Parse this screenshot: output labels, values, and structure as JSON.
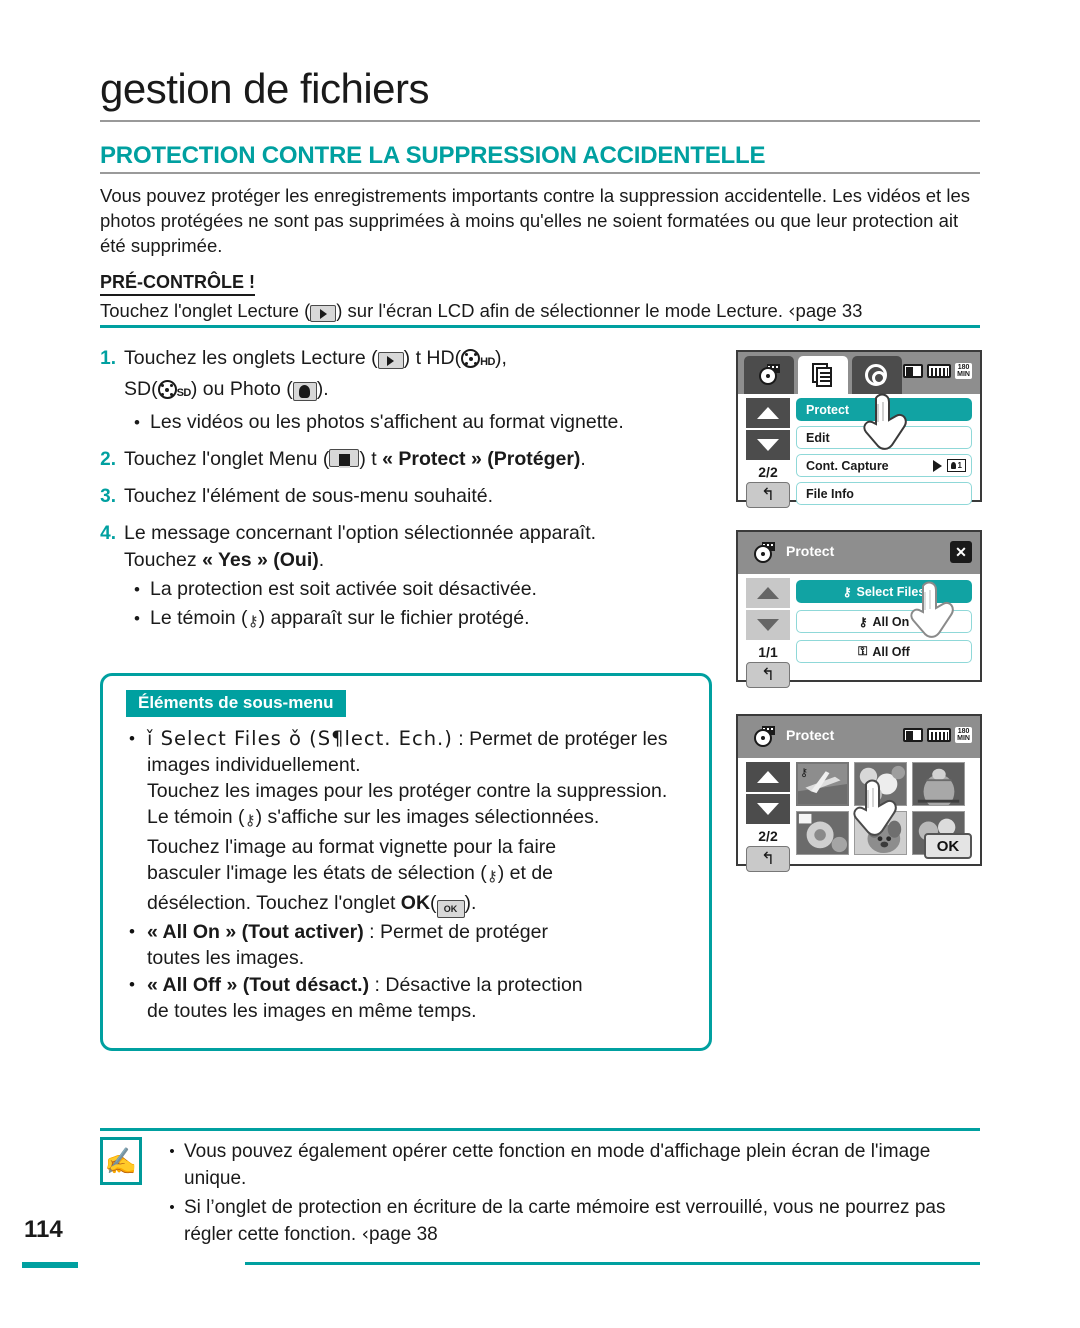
{
  "header": {
    "chapter_title": "gestion de fichiers",
    "section_title": "PROTECTION CONTRE LA SUPPRESSION ACCIDENTELLE"
  },
  "intro": "Vous pouvez protéger les enregistrements importants contre la suppression accidentelle. Les vidéos et les photos protégées ne sont pas supprimées à moins qu'elles ne soient formatées ou que leur protection ait été supprimée.",
  "precheck": {
    "label": "PRÉ-CONTRÔLE !",
    "text_before": "Touchez l'onglet Lecture (",
    "text_after": ") sur l'écran LCD afin de sélectionner le mode Lecture.",
    "page_ref": "page 33",
    "page_arrow": "‹"
  },
  "steps": [
    {
      "num": "1.",
      "seg1": "Touchez les onglets Lecture (",
      "seg2": ")",
      "arrow": "t",
      "seg3": "HD(",
      "hd_label": "HD",
      "seg4": "),",
      "line2_a": "SD(",
      "sd_label": "SD",
      "line2_b": ") ou Photo (",
      "line2_c": ").",
      "bullets": [
        "Les vidéos ou les photos s'affichent au format vignette."
      ]
    },
    {
      "num": "2.",
      "seg1": "Touchez l'onglet Menu (",
      "seg2": ")",
      "arrow": "t",
      "bold": "« Protect » (Protéger)",
      "seg3": "."
    },
    {
      "num": "3.",
      "text": "Touchez l'élément de sous-menu souhaité."
    },
    {
      "num": "4.",
      "line1": "Le message concernant l'option sélectionnée apparaît.",
      "line2_pre": "Touchez ",
      "line2_bold": "« Yes » (Oui)",
      "line2_post": ".",
      "bullets": [
        "La protection est soit activée soit désactivée.",
        "Le témoin (  ) apparaît sur le fichier protégé."
      ],
      "bullet2_pre": "Le témoin (",
      "bullet2_post": ") apparaît sur le fichier protégé."
    }
  ],
  "submenu": {
    "badge": "Éléments de sous-menu",
    "items": [
      {
        "title_raw": "ǐ Select Files ǒ (S¶lect. Ech.)",
        "desc": " : Permet de protéger les images individuellement.",
        "lines": [
          "Touchez les images pour les protéger contre la suppression.",
          "Le témoin (  ) s'affiche sur les images sélectionnées.",
          "Touchez l'image au format vignette pour la faire",
          "basculer l'image les états de sélection (  ) et de",
          "désélection. Touchez l'onglet OK(  )."
        ],
        "l2_pre": "Le témoin (",
        "l2_post": ") s'affiche sur les images sélectionnées.",
        "l4_pre": "basculer l'image les états de sélection (",
        "l4_post": ") et de",
        "l5_pre": "désélection. Touchez l'onglet ",
        "l5_bold": "OK",
        "l5_mid": "(",
        "l5_post": ")."
      },
      {
        "bold": "« All On » (Tout activer)",
        "desc": " : Permet de protéger",
        "line2": "toutes les images."
      },
      {
        "bold": "« All Off » (Tout désact.)",
        "desc": " : Désactive la protection",
        "line2": "de toutes les images en même temps."
      }
    ]
  },
  "lcd_screens": [
    {
      "name": "menu-screen",
      "status": {
        "battery_min": "180",
        "min_label": "MIN"
      },
      "page_indicator": "2/2",
      "back_glyph": "↰",
      "items": [
        {
          "label": "Protect",
          "selected": true
        },
        {
          "label": "Edit",
          "selected": false
        },
        {
          "label": "Cont. Capture",
          "selected": false,
          "has_arrow": true,
          "badge": "1"
        },
        {
          "label": "File Info",
          "selected": false
        }
      ]
    },
    {
      "name": "protect-submenu-screen",
      "title": "Protect",
      "close_label": "✕",
      "page_indicator": "1/1",
      "back_glyph": "↰",
      "items": [
        {
          "label": "Select Files",
          "selected": true,
          "icon": "key-icon"
        },
        {
          "label": "All On",
          "selected": false,
          "icon": "key-icon"
        },
        {
          "label": "All Off",
          "selected": false,
          "icon": "key-off-icon"
        }
      ]
    },
    {
      "name": "thumbnail-select-screen",
      "title": "Protect",
      "status": {
        "battery_min": "180",
        "min_label": "MIN"
      },
      "page_indicator": "2/2",
      "back_glyph": "↰",
      "ok_label": "OK",
      "thumbnails": [
        {
          "id": "thumb-1",
          "protected": true
        },
        {
          "id": "thumb-2",
          "protected": false
        },
        {
          "id": "thumb-3",
          "protected": false
        },
        {
          "id": "thumb-4",
          "protected": false
        },
        {
          "id": "thumb-5",
          "protected": false
        },
        {
          "id": "thumb-6",
          "protected": false
        }
      ]
    }
  ],
  "notes": {
    "items": [
      "Vous pouvez également opérer cette fonction en mode d'affichage plein écran de l'image unique.",
      "Si l’onglet de protection en écriture de la carte mémoire est verrouillé, vous ne pourrez pas régler cette fonction."
    ],
    "page_ref": "page 38",
    "page_arrow": "‹"
  },
  "page_number": "114",
  "colors": {
    "accent": "#00a0a0",
    "text": "#1a1a1a",
    "lcd_selected": "#11a3a3"
  }
}
